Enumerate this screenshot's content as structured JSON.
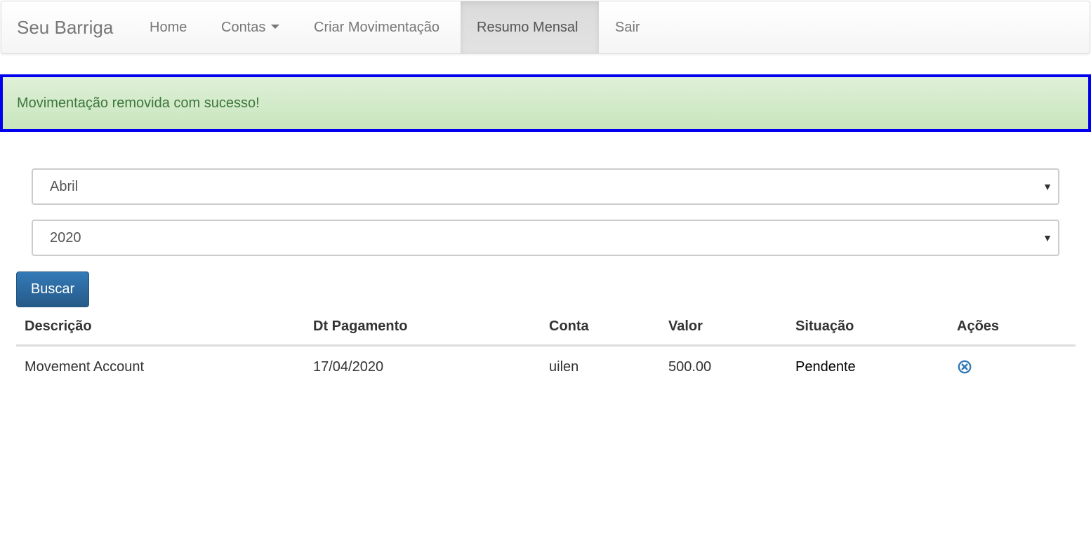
{
  "navbar": {
    "brand": "Seu Barriga",
    "items": [
      {
        "label": "Home"
      },
      {
        "label": "Contas"
      },
      {
        "label": "Criar Movimentação"
      },
      {
        "label": "Resumo Mensal"
      },
      {
        "label": "Sair"
      }
    ],
    "active_item": "Resumo Mensal",
    "dropdown_icon": "caret-down-icon"
  },
  "alert": {
    "message": "Movimentação removida com sucesso!",
    "type": "success",
    "background": "#dff0d8",
    "text_color": "#3c763d",
    "outline_color": "#0000ee"
  },
  "filters": {
    "month": {
      "selected": "Abril",
      "icon": "dropdown-arrow-icon"
    },
    "year": {
      "selected": "2020",
      "icon": "dropdown-arrow-icon"
    },
    "search_button": "Buscar"
  },
  "table": {
    "headers": [
      "Descrição",
      "Dt Pagamento",
      "Conta",
      "Valor",
      "Situação",
      "Ações"
    ],
    "rows": [
      {
        "descricao": "Movement Account",
        "dt_pagamento": "17/04/2020",
        "conta": "uilen",
        "valor": "500.00",
        "situacao": "Pendente",
        "action_icon": "remove-circle-icon"
      }
    ]
  },
  "colors": {
    "primary": "#337ab7",
    "icon_blue": "#337ab7"
  }
}
